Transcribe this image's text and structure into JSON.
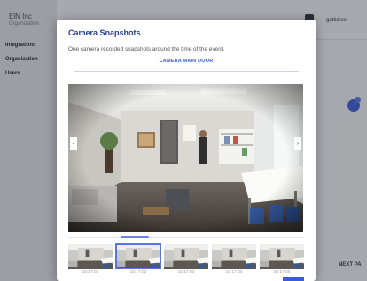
{
  "background": {
    "org_name": "ElN Inc",
    "org_sub": "Organization",
    "nav": [
      "Integrations",
      "Organization",
      "Users"
    ],
    "user_email": "gettid.co",
    "next_label": "NEXT PA"
  },
  "modal": {
    "title": "Camera Snapshots",
    "description": "One camera recorded snapshots around the time of the event.",
    "camera_link": "CAMERA MAIN DOOR",
    "prev_arrow": "‹",
    "next_arrow": "›"
  },
  "thumbnails": [
    {
      "time": "10:17:01",
      "selected": false
    },
    {
      "time": "10:17:02",
      "selected": true
    },
    {
      "time": "10:17:03",
      "selected": false
    },
    {
      "time": "10:17:04",
      "selected": false
    },
    {
      "time": "10:17:05",
      "selected": false
    }
  ],
  "colors": {
    "accent": "#3b5bdb",
    "title": "#263c8f",
    "selected_outline": "#5b74e3"
  }
}
